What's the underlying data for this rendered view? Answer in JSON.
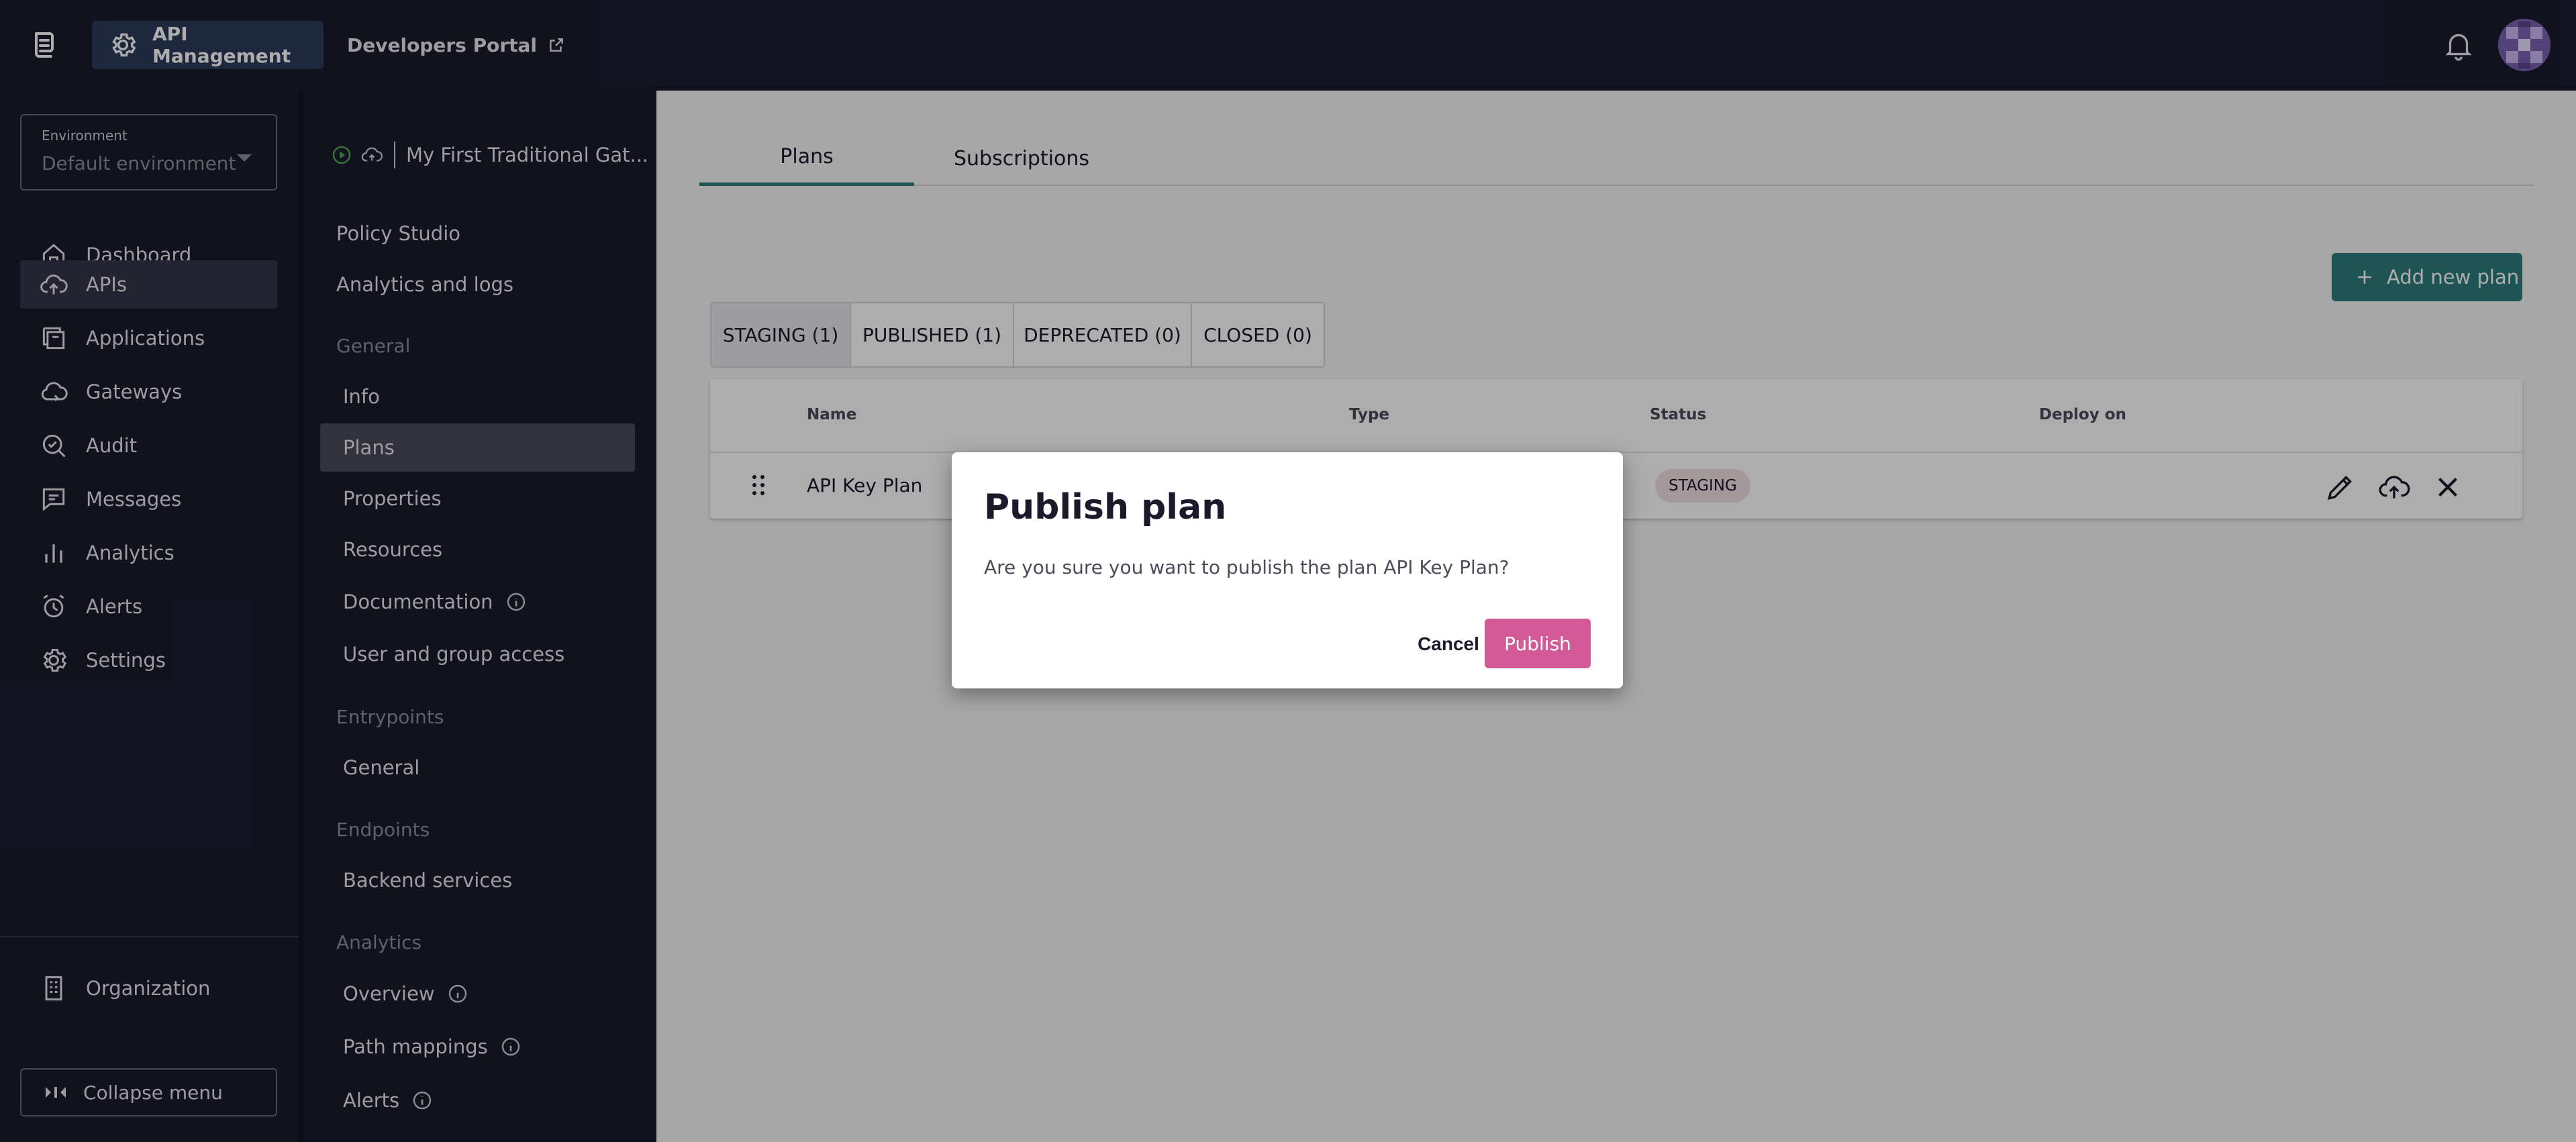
{
  "topbar": {
    "product_label": "API Management",
    "portal_label": "Developers Portal",
    "icons": [
      "gravitee-logo-icon",
      "gear-icon",
      "external-link-icon",
      "bell-icon",
      "avatar"
    ]
  },
  "mainnav": {
    "environment": {
      "label": "Environment",
      "value": "Default environment"
    },
    "items": [
      {
        "label": "Dashboard",
        "icon": "home-icon",
        "active": false
      },
      {
        "label": "APIs",
        "icon": "cloud-upload-icon",
        "active": true
      },
      {
        "label": "Applications",
        "icon": "applications-icon",
        "active": false
      },
      {
        "label": "Gateways",
        "icon": "cloud-icon",
        "active": false
      },
      {
        "label": "Audit",
        "icon": "audit-icon",
        "active": false
      },
      {
        "label": "Messages",
        "icon": "messages-icon",
        "active": false
      },
      {
        "label": "Analytics",
        "icon": "bar-chart-icon",
        "active": false
      },
      {
        "label": "Alerts",
        "icon": "alarm-icon",
        "active": false
      },
      {
        "label": "Settings",
        "icon": "gear-icon",
        "active": false
      }
    ],
    "organization": "Organization",
    "collapse": "Collapse menu"
  },
  "subnav": {
    "api_name": "My First Traditional Gat...",
    "top_items": [
      "Policy Studio",
      "Analytics and logs"
    ],
    "sections": {
      "general": "General",
      "entrypoints": "Entrypoints",
      "endpoints": "Endpoints",
      "analytics": "Analytics"
    },
    "general_items": [
      "Info",
      "Plans",
      "Properties",
      "Resources",
      "Documentation",
      "User and group access"
    ],
    "entrypoints_items": [
      "General"
    ],
    "endpoints_items": [
      "Backend services"
    ],
    "analytics_items": [
      "Overview",
      "Path mappings",
      "Alerts"
    ]
  },
  "content": {
    "tabs": [
      "Plans",
      "Subscriptions"
    ],
    "add_plan_label": "Add new plan",
    "filters": [
      "STAGING (1)",
      "PUBLISHED (1)",
      "DEPRECATED (0)",
      "CLOSED (0)"
    ],
    "table": {
      "headers": [
        "Name",
        "Type",
        "Status",
        "Deploy on"
      ],
      "rows": [
        {
          "name": "API Key Plan",
          "type": "",
          "status": "STAGING",
          "deploy_on": ""
        }
      ]
    }
  },
  "dialog": {
    "title": "Publish plan",
    "message": "Are you sure you want to publish the plan API Key Plan?",
    "cancel": "Cancel",
    "confirm": "Publish"
  },
  "colors": {
    "nav_bg": "#1b1b2f",
    "accent_teal": "#2e7d7d",
    "publish_pink": "#d35a96",
    "staging_badge": "#f3e1e3"
  }
}
